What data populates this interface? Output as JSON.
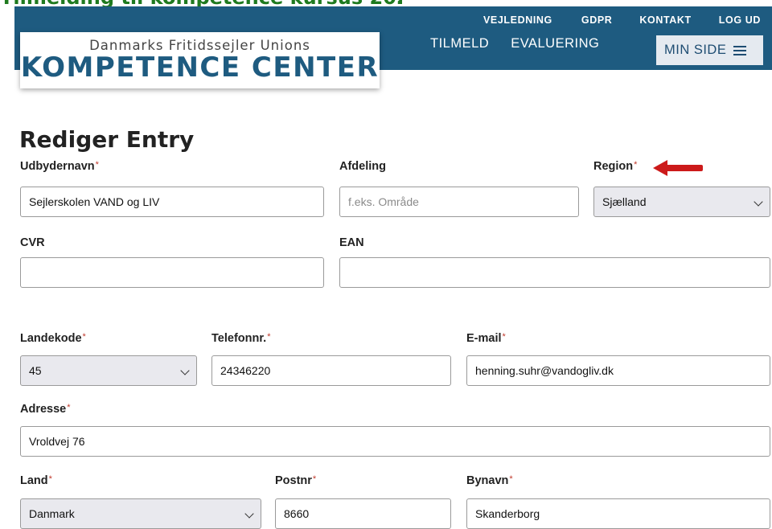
{
  "header": {
    "util_nav": [
      "VEJLEDNING",
      "GDPR",
      "KONTAKT",
      "LOG UD"
    ],
    "main_nav": [
      "TILMELD",
      "EVALUERING"
    ],
    "min_side": "MIN SIDE",
    "logo_sub": "Danmarks Fritidssejler Unions",
    "logo_main": "KOMPETENCE CENTER",
    "bar_color": "#1e5b80"
  },
  "page": {
    "title": "Rediger Entry"
  },
  "form": {
    "udbydernavn": {
      "label": "Udbydernavn",
      "value": "Sejlerskolen VAND og LIV"
    },
    "afdeling": {
      "label": "Afdeling",
      "placeholder": "f.eks. Område"
    },
    "region": {
      "label": "Region",
      "value": "Sjælland"
    },
    "cvr": {
      "label": "CVR",
      "value": ""
    },
    "ean": {
      "label": "EAN",
      "value": ""
    },
    "landekode": {
      "label": "Landekode",
      "value": "45"
    },
    "telefon": {
      "label": "Telefonnr.",
      "value": "24346220"
    },
    "email": {
      "label": "E-mail",
      "value": "henning.suhr@vandogliv.dk"
    },
    "adresse": {
      "label": "Adresse",
      "value": "Vroldvej 76"
    },
    "land": {
      "label": "Land",
      "value": "Danmark"
    },
    "postnr": {
      "label": "Postnr",
      "value": "8660"
    },
    "bynavn": {
      "label": "Bynavn",
      "value": "Skanderborg"
    },
    "required_mark": "*"
  },
  "annotation": {
    "arrow_color": "#cc1a1a",
    "icon": "red-arrow-left"
  }
}
